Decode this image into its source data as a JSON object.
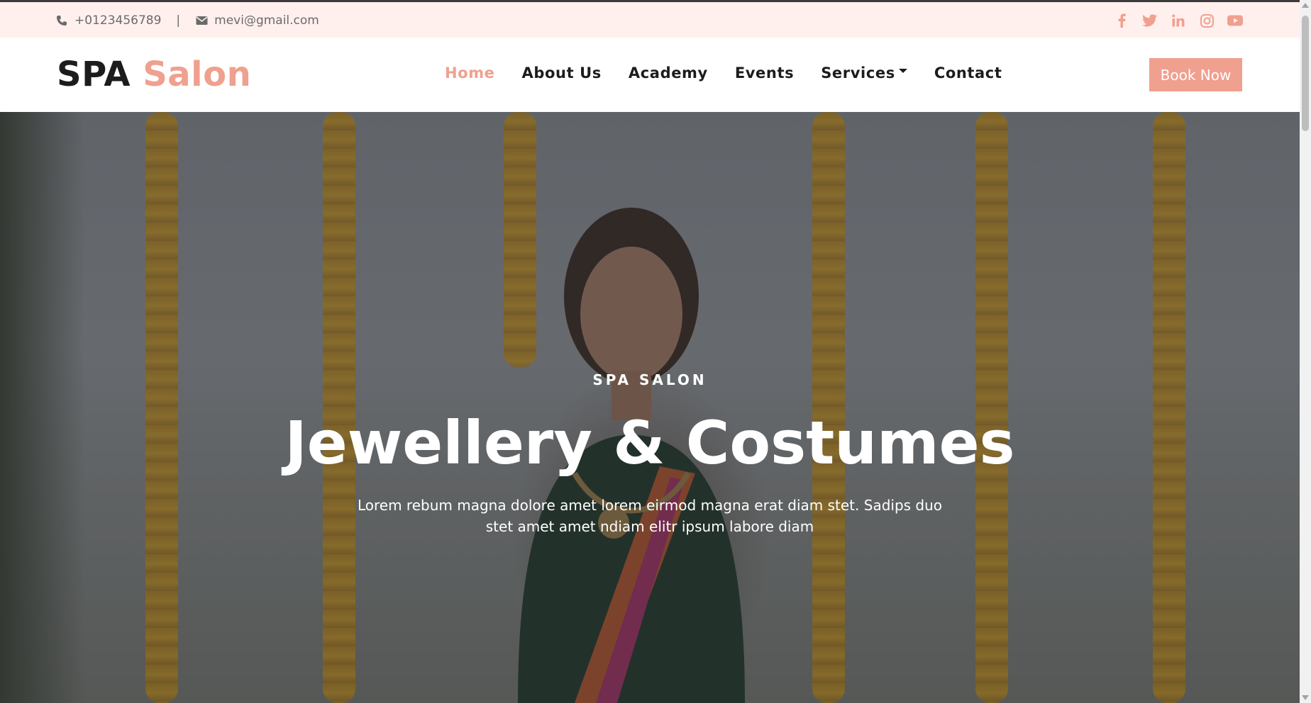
{
  "topbar": {
    "phone": "+0123456789",
    "separator": "|",
    "email": "mevi@gmail.com",
    "phone_icon": "phone-icon",
    "email_icon": "envelope-icon",
    "socials": [
      "facebook-icon",
      "twitter-icon",
      "linkedin-icon",
      "instagram-icon",
      "youtube-icon"
    ]
  },
  "brand": {
    "part1": "SPA",
    "part2": "Salon"
  },
  "nav": {
    "items": [
      {
        "label": "Home"
      },
      {
        "label": "About Us"
      },
      {
        "label": "Academy"
      },
      {
        "label": "Events"
      },
      {
        "label": "Services"
      },
      {
        "label": "Contact"
      }
    ],
    "active": "Home",
    "book_label": "Book Now"
  },
  "hero": {
    "eyebrow": "SPA SALON",
    "headline": "Jewellery & Costumes",
    "subtitle": "Lorem rebum magna dolore amet lorem eirmod magna erat diam stet. Sadips duo stet amet amet ndiam elitr ipsum labore diam"
  },
  "colors": {
    "accent": "#f0a08e",
    "topbar_bg": "#fff0ee",
    "text_dark": "#1c1c1c",
    "text_muted": "#6b6b6b"
  }
}
